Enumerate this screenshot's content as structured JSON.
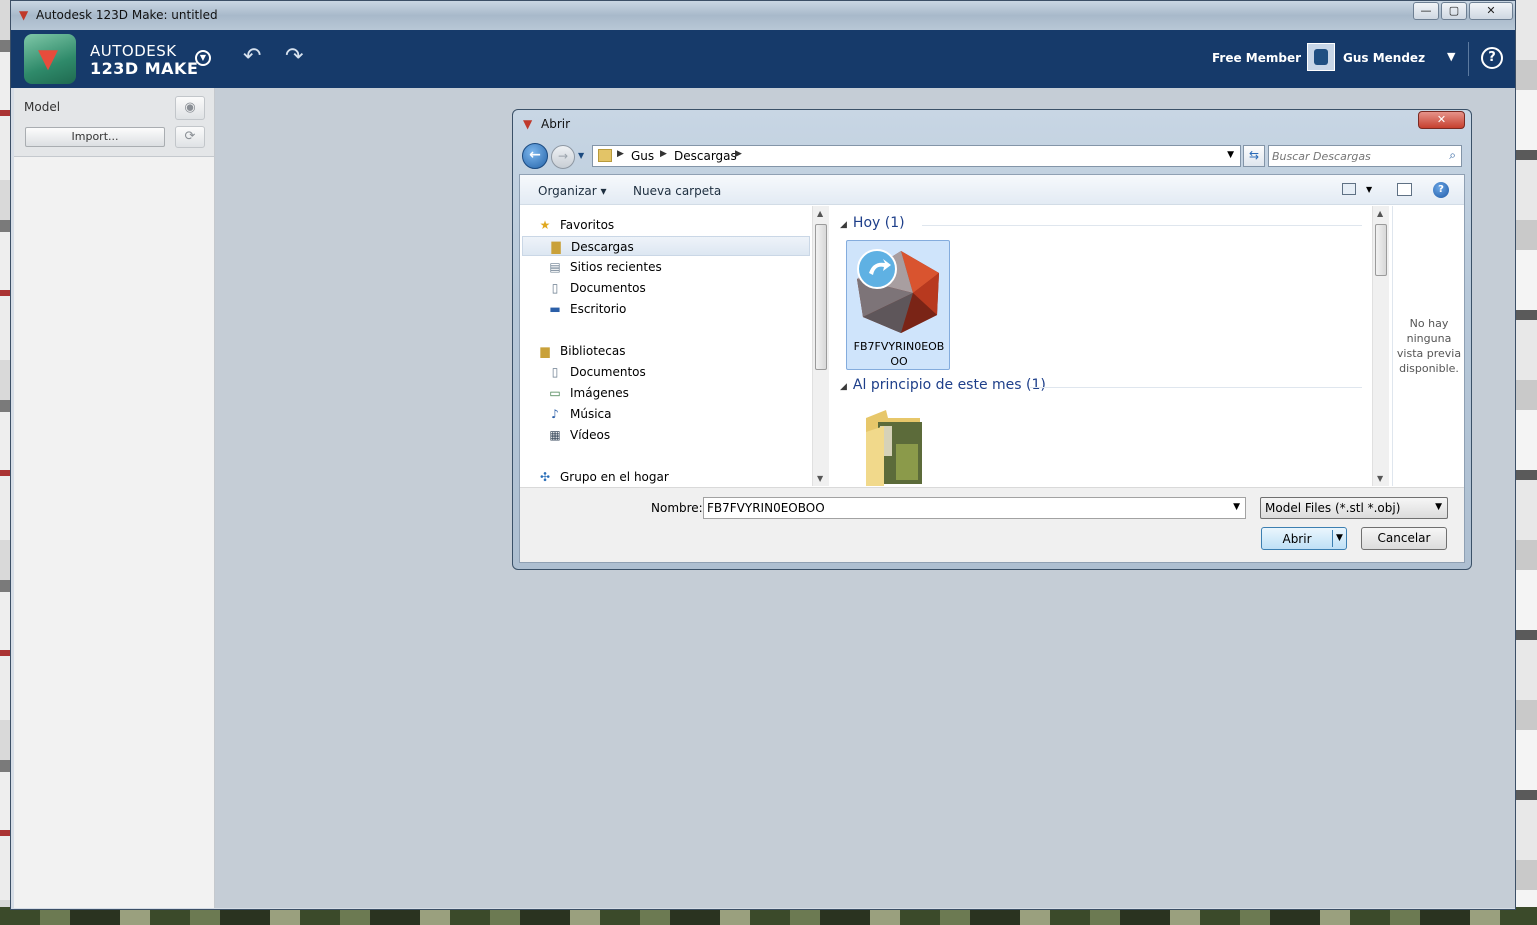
{
  "window": {
    "title": "Autodesk 123D Make: untitled",
    "minimize": "—",
    "maximize": "▢",
    "close": "✕"
  },
  "app": {
    "brand_line1": "AUTODESK",
    "brand_line2": "123D MAKE",
    "membership": "Free Member",
    "username": "Gus Mendez",
    "help": "?"
  },
  "sidebar": {
    "section_label": "Model",
    "import_button": "Import..."
  },
  "dialog": {
    "title": "Abrir",
    "close": "✕",
    "breadcrumb": [
      "Gus",
      "Descargas"
    ],
    "search_placeholder": "Buscar Descargas",
    "toolbar": {
      "organize": "Organizar ▾",
      "new_folder": "Nueva carpeta"
    },
    "nav": {
      "favorites": {
        "label": "Favoritos",
        "items": [
          "Descargas",
          "Sitios recientes",
          "Documentos",
          "Escritorio"
        ]
      },
      "libraries": {
        "label": "Bibliotecas",
        "items": [
          "Documentos",
          "Imágenes",
          "Música",
          "Vídeos"
        ]
      },
      "homegroup": "Grupo en el hogar"
    },
    "groups": [
      {
        "header": "Hoy (1)",
        "file": "FB7FVYRIN0EOBOO"
      },
      {
        "header": "Al principio de este mes (1)"
      }
    ],
    "preview_message": "No hay ninguna vista previa disponible.",
    "filename_label": "Nombre:",
    "filename_value": "FB7FVYRIN0EOBOO",
    "filetype": "Model Files (*.stl *.obj)",
    "open_button": "Abrir",
    "cancel_button": "Cancelar"
  }
}
